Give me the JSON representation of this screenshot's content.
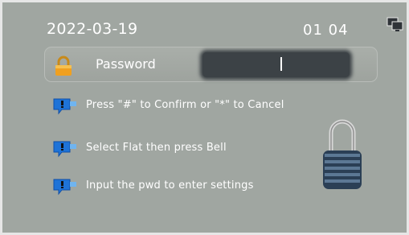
{
  "header": {
    "date": "2022-03-19",
    "time": "01 04",
    "network_icon": "network-monitors-icon"
  },
  "password": {
    "label": "Password",
    "value": "",
    "lock_icon": "lock-icon"
  },
  "hints": [
    {
      "text": "Press \"#\" to Confirm or \"*\" to Cancel",
      "icon": "info-speech-icon"
    },
    {
      "text": "Select Flat then press Bell",
      "icon": "info-speech-icon"
    },
    {
      "text": "Input the pwd to enter settings",
      "icon": "info-speech-icon"
    }
  ],
  "side_icon": "padlock-icon",
  "colors": {
    "background": "#a0a6a1",
    "input": "#3c4246",
    "text": "#ffffff",
    "icon_blue": "#1e73d8"
  }
}
